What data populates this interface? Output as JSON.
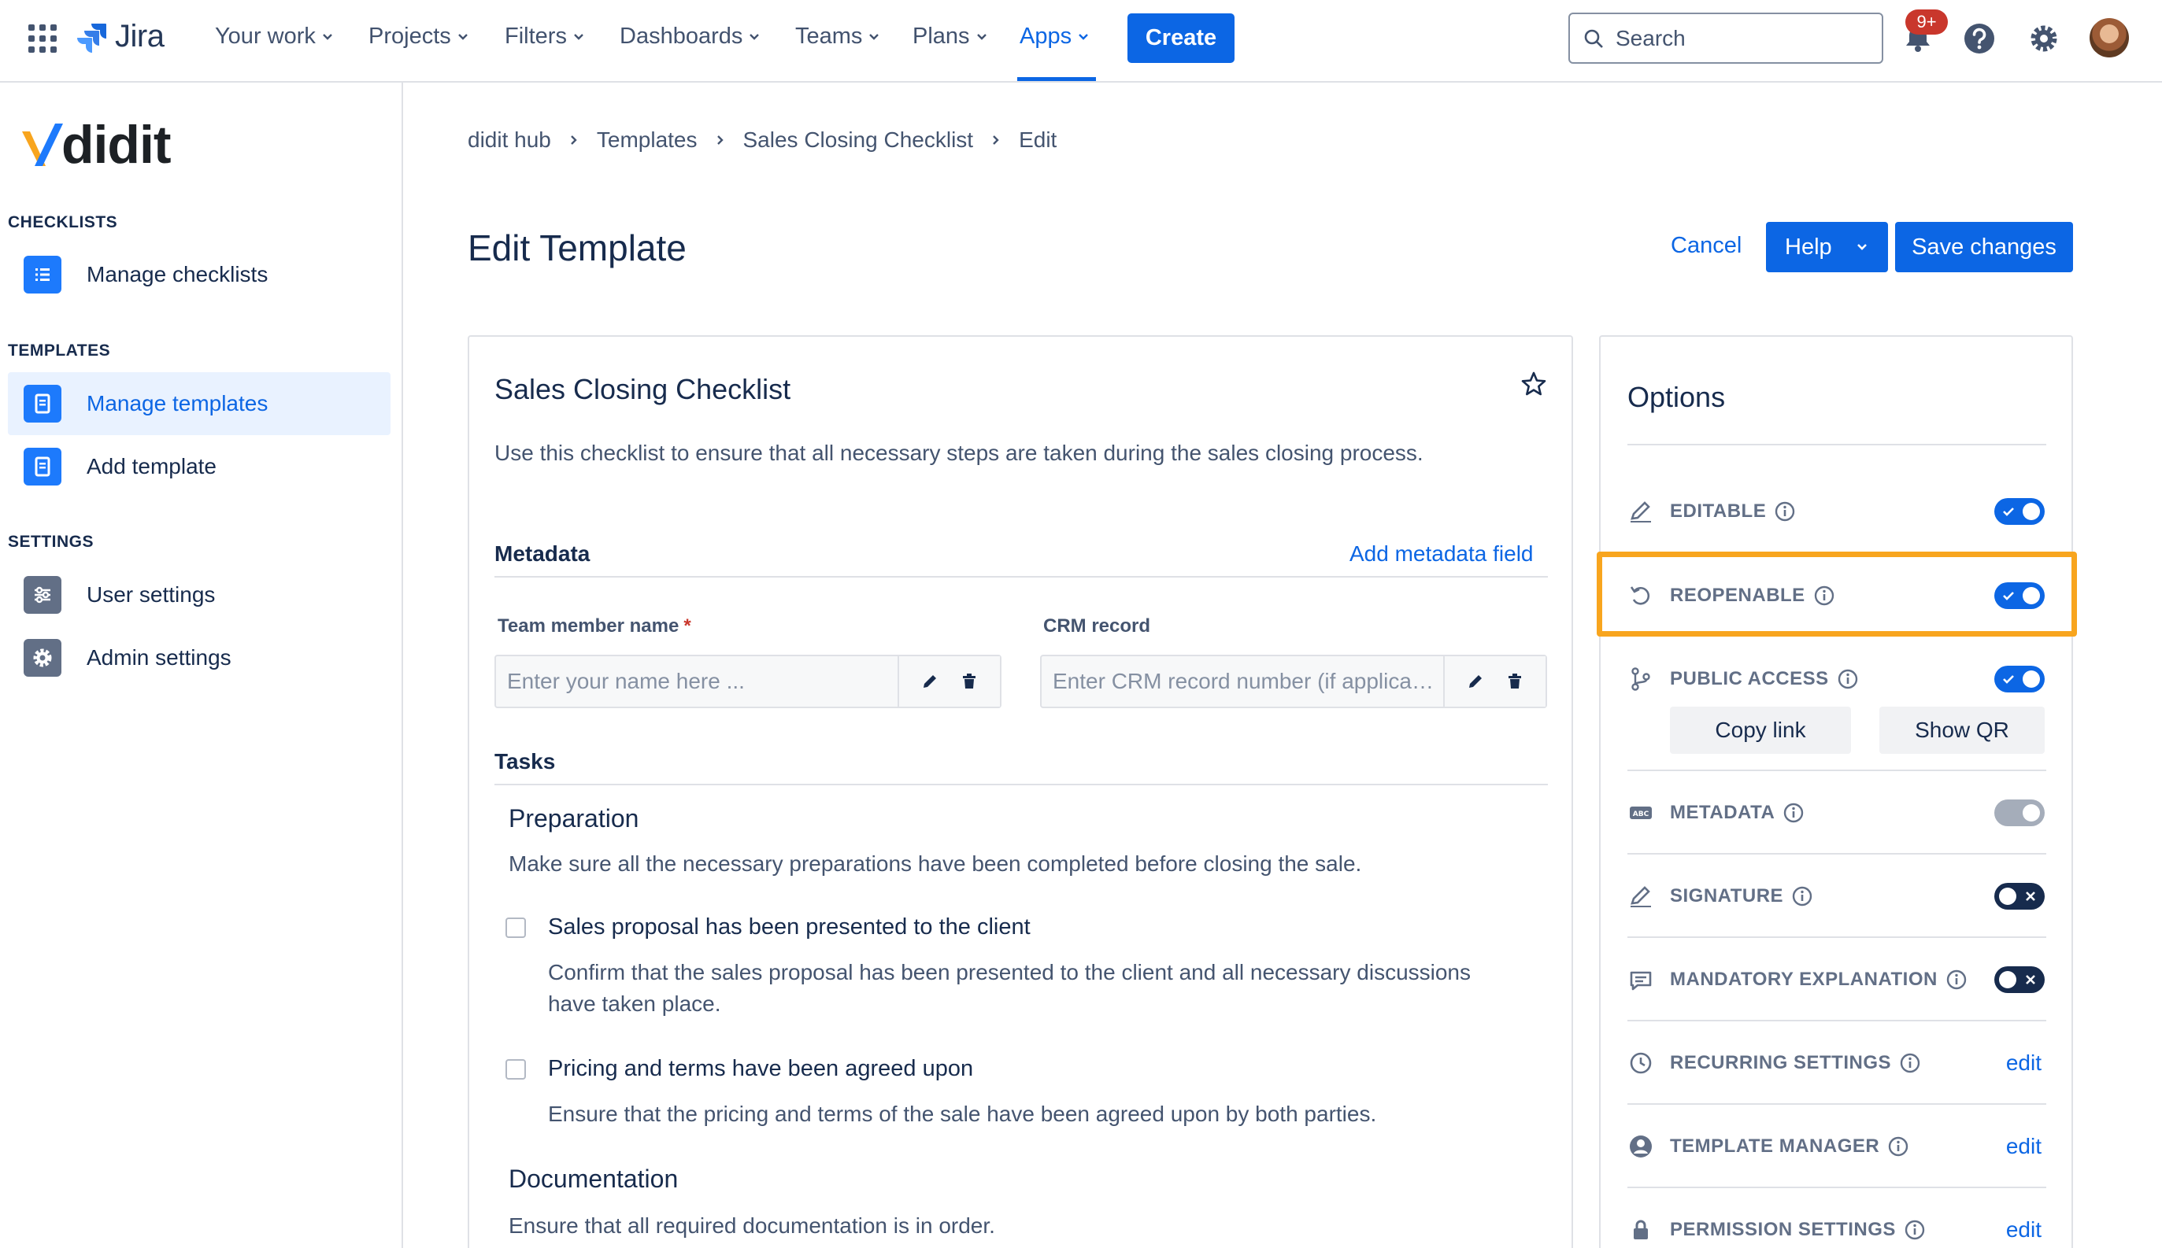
{
  "topnav": {
    "product": "Jira",
    "items": [
      {
        "label": "Your work"
      },
      {
        "label": "Projects"
      },
      {
        "label": "Filters"
      },
      {
        "label": "Dashboards"
      },
      {
        "label": "Teams"
      },
      {
        "label": "Plans"
      },
      {
        "label": "Apps"
      }
    ],
    "active_item": "Apps",
    "create_label": "Create",
    "search_placeholder": "Search",
    "notifications_badge": "9+",
    "accent_color": "#0c66e4"
  },
  "sidebar": {
    "brand": "didit",
    "sections": [
      {
        "title": "CHECKLISTS",
        "items": [
          {
            "label": "Manage checklists",
            "icon": "list-icon"
          }
        ]
      },
      {
        "title": "TEMPLATES",
        "items": [
          {
            "label": "Manage templates",
            "icon": "document-icon",
            "selected": true
          },
          {
            "label": "Add template",
            "icon": "document-icon"
          }
        ]
      },
      {
        "title": "SETTINGS",
        "items": [
          {
            "label": "User settings",
            "icon": "sliders-icon"
          },
          {
            "label": "Admin settings",
            "icon": "gear-icon"
          }
        ]
      }
    ]
  },
  "breadcrumb": [
    "didit hub",
    "Templates",
    "Sales Closing Checklist",
    "Edit"
  ],
  "page": {
    "title": "Edit Template",
    "cancel_label": "Cancel",
    "help_label": "Help",
    "save_label": "Save changes"
  },
  "template": {
    "name": "Sales Closing Checklist",
    "description": "Use this checklist to ensure that all necessary steps are taken during the sales closing process.",
    "metadata_heading": "Metadata",
    "add_metadata_label": "Add metadata field",
    "fields": [
      {
        "label": "Team member name",
        "required": true,
        "required_mark": "*",
        "placeholder": "Enter your name here ..."
      },
      {
        "label": "CRM record",
        "required": false,
        "placeholder": "Enter CRM record number (if applicable)"
      }
    ],
    "tasks_heading": "Tasks",
    "groups": [
      {
        "title": "Preparation",
        "description": "Make sure all the necessary preparations have been completed before closing the sale.",
        "tasks": [
          {
            "title": "Sales proposal has been presented to the client",
            "description": "Confirm that the sales proposal has been presented to the client and all necessary discussions have taken place.",
            "checked": false
          },
          {
            "title": "Pricing and terms have been agreed upon",
            "description": "Ensure that the pricing and terms of the sale have been agreed upon by both parties.",
            "checked": false
          }
        ]
      },
      {
        "title": "Documentation",
        "description": "Ensure that all required documentation is in order.",
        "tasks": []
      }
    ]
  },
  "options": {
    "title": "Options",
    "rows": [
      {
        "label": "EDITABLE",
        "icon": "pen-icon",
        "control": "toggle",
        "state": "on"
      },
      {
        "label": "REOPENABLE",
        "icon": "undo-icon",
        "control": "toggle",
        "state": "on",
        "highlighted": true
      },
      {
        "label": "PUBLIC ACCESS",
        "icon": "branch-icon",
        "control": "toggle",
        "state": "on"
      },
      {
        "label": "METADATA",
        "icon": "abc-icon",
        "control": "toggle",
        "state": "disabled"
      },
      {
        "label": "SIGNATURE",
        "icon": "pen-icon",
        "control": "toggle",
        "state": "off"
      },
      {
        "label": "MANDATORY EXPLANATION",
        "icon": "comment-icon",
        "control": "toggle",
        "state": "off"
      },
      {
        "label": "RECURRING SETTINGS",
        "icon": "clock-icon",
        "control": "link",
        "link_label": "edit"
      },
      {
        "label": "TEMPLATE MANAGER",
        "icon": "person-icon",
        "control": "link",
        "link_label": "edit"
      },
      {
        "label": "PERMISSION SETTINGS",
        "icon": "lock-icon",
        "control": "link",
        "link_label": "edit"
      }
    ],
    "copy_link_label": "Copy link",
    "show_qr_label": "Show QR",
    "highlight_color": "#f8a51e"
  }
}
